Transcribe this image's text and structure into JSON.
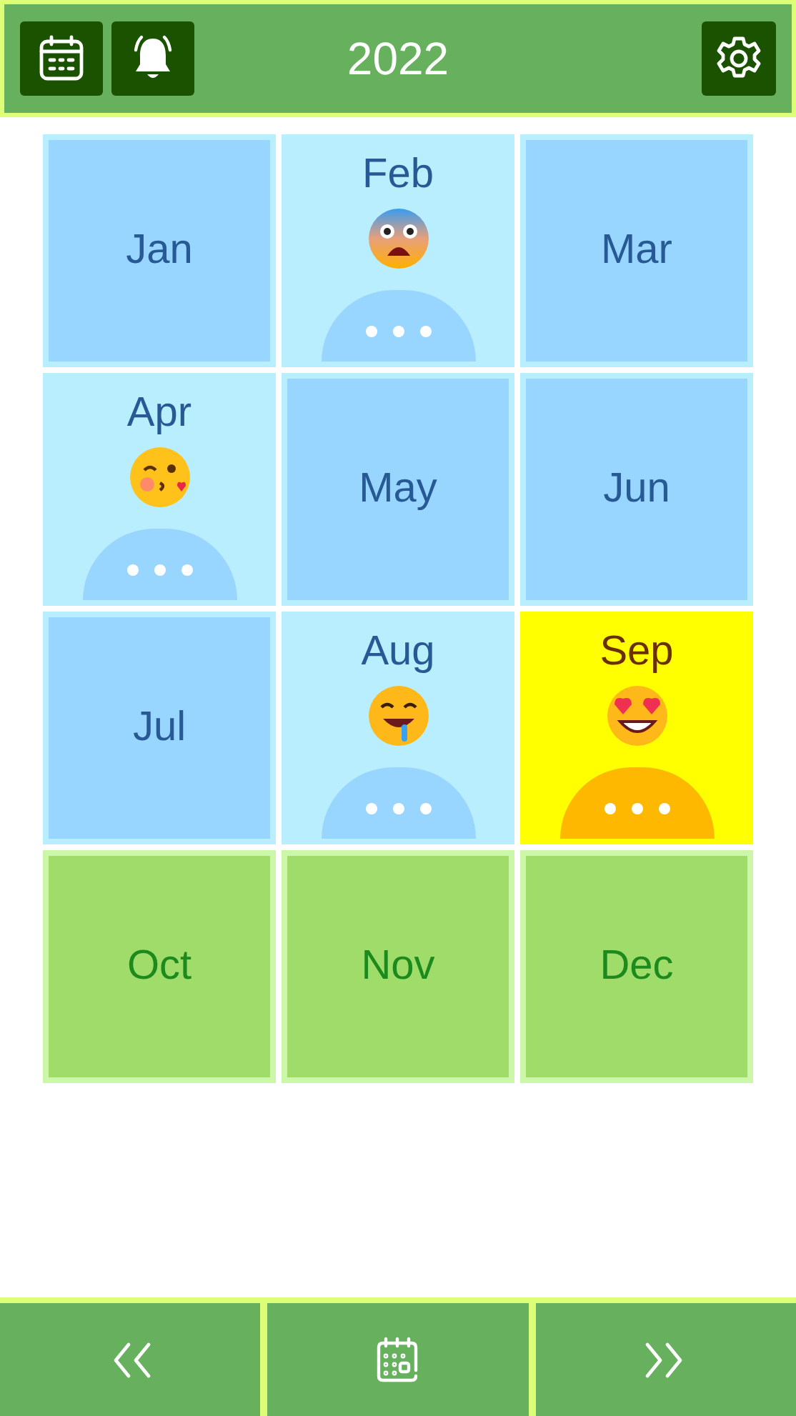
{
  "header": {
    "title": "2022"
  },
  "months": [
    {
      "label": "Jan",
      "kind": "past"
    },
    {
      "label": "Feb",
      "kind": "entry",
      "emoji": {
        "kind": "scared"
      }
    },
    {
      "label": "Mar",
      "kind": "past"
    },
    {
      "label": "Apr",
      "kind": "entry",
      "emoji": {
        "kind": "kiss"
      }
    },
    {
      "label": "May",
      "kind": "past"
    },
    {
      "label": "Jun",
      "kind": "past"
    },
    {
      "label": "Jul",
      "kind": "past"
    },
    {
      "label": "Aug",
      "kind": "entry",
      "emoji": {
        "kind": "drool"
      }
    },
    {
      "label": "Sep",
      "kind": "current",
      "emoji": {
        "kind": "love"
      }
    },
    {
      "label": "Oct",
      "kind": "future"
    },
    {
      "label": "Nov",
      "kind": "future"
    },
    {
      "label": "Dec",
      "kind": "future"
    }
  ]
}
